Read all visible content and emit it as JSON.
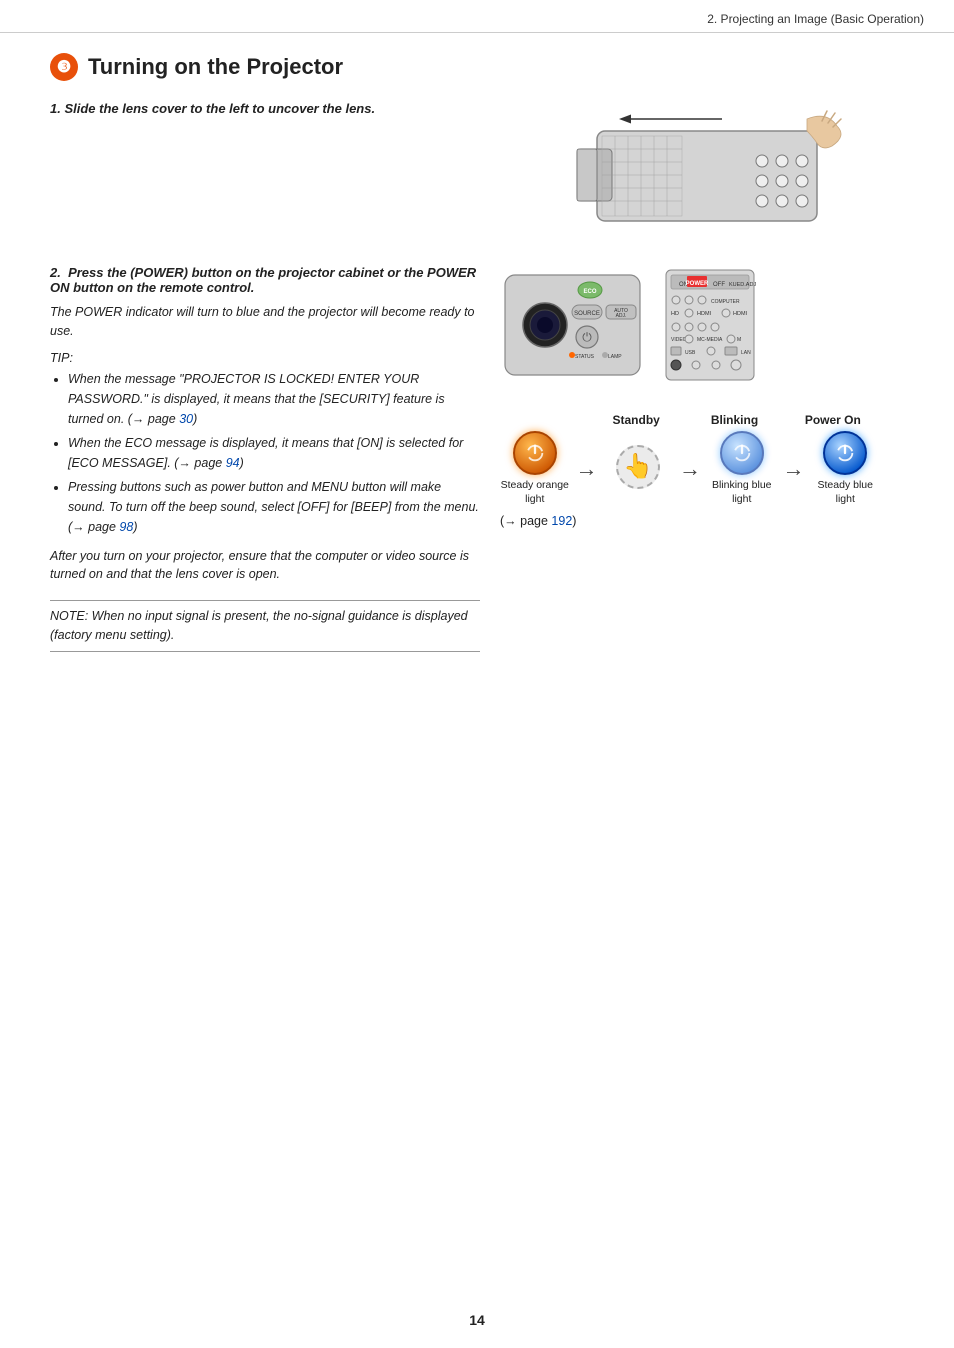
{
  "header": {
    "text": "2. Projecting an Image (Basic Operation)"
  },
  "section": {
    "number": "❸",
    "title": "Turning on the Projector"
  },
  "step1": {
    "label": "1.  Slide the lens cover to the left to uncover the lens."
  },
  "step2": {
    "label": "2.",
    "bold_text": "Press the  (POWER) button on the projector cabinet or the POWER ON button on the remote control.",
    "body": "The POWER indicator will turn to blue and the projector will become ready to use.",
    "tip_label": "TIP:",
    "bullets": [
      {
        "text": "When the message \"PROJECTOR IS LOCKED! ENTER YOUR PASSWORD.\" is displayed, it means that the [SECURITY] feature is turned on. (→ page ",
        "link": "30",
        "text2": ")"
      },
      {
        "text": "When the ECO message is displayed, it means that [ON] is selected for [ECO MESSAGE]. (→ page ",
        "link": "94",
        "text2": ")"
      },
      {
        "text": "Pressing buttons such as power button and MENU button will make sound. To turn off the beep sound, select [OFF] for [BEEP] from the menu. (→ page ",
        "link": "98",
        "text2": ")"
      }
    ],
    "after_tip": "After you turn on your projector, ensure that the computer or video source is turned on and that the lens cover is open."
  },
  "note": "NOTE: When no input signal is present, the no-signal guidance is displayed (factory menu setting).",
  "indicator_states": {
    "standby_label": "Standby",
    "blinking_label": "Blinking",
    "power_on_label": "Power On",
    "items": [
      {
        "type": "orange",
        "label": "Steady orange light"
      },
      {
        "type": "finger",
        "label": ""
      },
      {
        "type": "blue_blink",
        "label": "Blinking blue light"
      },
      {
        "type": "blue_solid",
        "label": "Steady blue light"
      }
    ]
  },
  "arrow_ref": {
    "text": "(→ page ",
    "link": "192",
    "text2": ")"
  },
  "page_number": "14"
}
